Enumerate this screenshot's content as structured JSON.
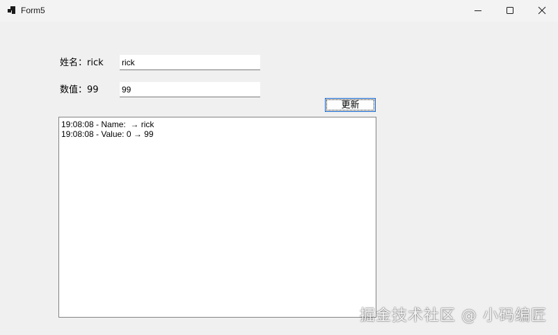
{
  "window": {
    "title": "Form5"
  },
  "form": {
    "name_label": "姓名：rick",
    "name_value": "rick",
    "value_label": "数值：99",
    "value_value": "99",
    "update_button": "更新"
  },
  "log": {
    "lines": [
      "19:08:08 - Name:  → rick",
      "19:08:08 - Value: 0 → 99"
    ]
  },
  "watermark": "掘金技术社区 @ 小码编匠",
  "icons": {
    "app": "app-icon",
    "minimize": "minimize-icon",
    "maximize": "maximize-icon",
    "close": "close-icon"
  }
}
